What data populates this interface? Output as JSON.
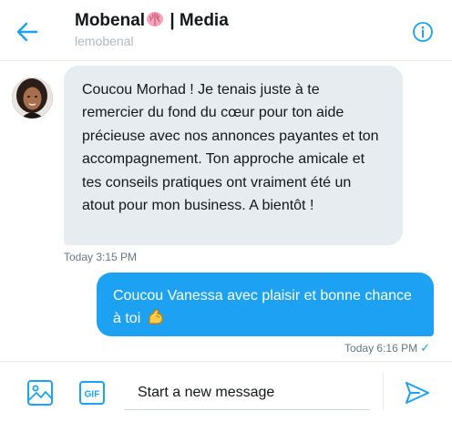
{
  "header": {
    "title_part1": "Mobenal",
    "title_part2": " | Media",
    "handle": "lemobenal",
    "icons": {
      "back": "arrow-left-icon",
      "info": "info-icon",
      "emoji": "brain-emoji"
    }
  },
  "messages": [
    {
      "direction": "incoming",
      "text": "Coucou Morhad ! Je tenais juste à te remercier du fond du cœur pour ton aide précieuse avec nos annonces payantes et ton accompagnement. Ton approche amicale et tes conseils pratiques ont vraiment été un atout pour mon business. A bientôt !",
      "time": "Today 3:15 PM"
    },
    {
      "direction": "outgoing",
      "text": "Coucou Vanessa avec plaisir et bonne chance à toi",
      "emoji": "flexed-biceps",
      "time": "Today 6:16 PM",
      "status": "sent-check"
    }
  ],
  "composer": {
    "placeholder": "Start a new message",
    "value": "",
    "icons": {
      "media": "image-icon",
      "gif": "gif-icon",
      "send": "send-icon"
    }
  },
  "colors": {
    "accent": "#1da1f2",
    "bubble_in": "#e6ecf0",
    "muted": "#657786"
  }
}
